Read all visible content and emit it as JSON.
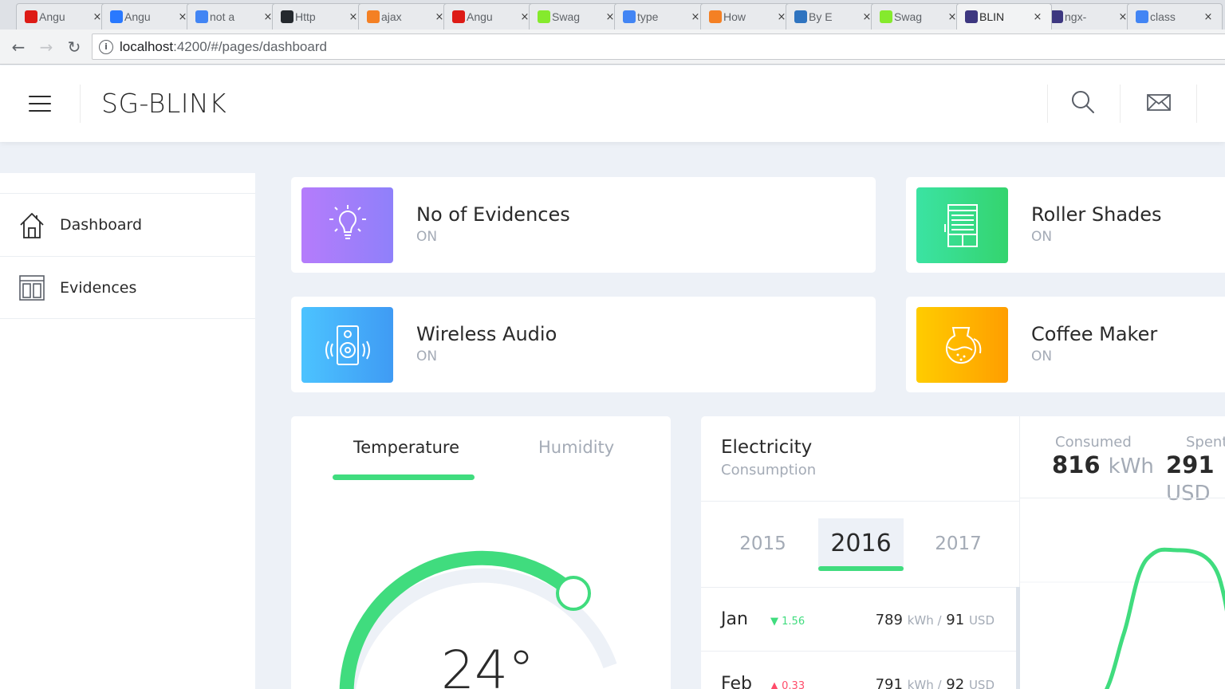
{
  "browser": {
    "tabs": [
      {
        "title": "Angu",
        "icon": "angular-icon",
        "color": "#dd1b16"
      },
      {
        "title": "Angu",
        "icon": "lightning-icon",
        "color": "#2979ff"
      },
      {
        "title": "not a",
        "icon": "google-icon",
        "color": "#4285f4"
      },
      {
        "title": "Http",
        "icon": "github-icon",
        "color": "#24292e"
      },
      {
        "title": "ajax",
        "icon": "stackoverflow-icon",
        "color": "#f48024"
      },
      {
        "title": "Angu",
        "icon": "angular-icon",
        "color": "#dd1b16"
      },
      {
        "title": "Swag",
        "icon": "swagger-icon",
        "color": "#85ea2d"
      },
      {
        "title": "type",
        "icon": "google-icon",
        "color": "#4285f4"
      },
      {
        "title": "How",
        "icon": "stackoverflow-icon",
        "color": "#f48024"
      },
      {
        "title": "By E",
        "icon": "typescript-icon",
        "color": "#2f74c0"
      },
      {
        "title": "Swag",
        "icon": "swagger-icon",
        "color": "#85ea2d"
      },
      {
        "title": "BLIN",
        "icon": "app-icon",
        "color": "#3d3780"
      },
      {
        "title": "ngx-",
        "icon": "app-icon",
        "color": "#3d3780"
      },
      {
        "title": "class",
        "icon": "google-icon",
        "color": "#4285f4"
      }
    ],
    "close_glyph": "×",
    "url_host": "localhost",
    "url_path": ":4200/#/pages/dashboard"
  },
  "header": {
    "brand": "SG-BLINK"
  },
  "sidebar": {
    "items": [
      {
        "label": "Dashboard",
        "icon": "home-icon"
      },
      {
        "label": "Evidences",
        "icon": "layout-icon"
      }
    ]
  },
  "status_cards": [
    {
      "title": "No of Evidences",
      "state": "ON",
      "icon": "light-bulb-icon",
      "gradient": [
        "#b57cfb",
        "#8f80fa"
      ]
    },
    {
      "title": "Roller Shades",
      "state": "ON",
      "icon": "roller-shades-icon",
      "gradient": [
        "#3be3a3",
        "#34d46e"
      ]
    },
    {
      "title": "Wireless Audio",
      "state": "ON",
      "icon": "speaker-icon",
      "gradient": [
        "#4cc3ff",
        "#3f9bf4"
      ]
    },
    {
      "title": "Coffee Maker",
      "state": "ON",
      "icon": "coffee-maker-icon",
      "gradient": [
        "#ffcc00",
        "#ff9e00"
      ]
    }
  ],
  "temperature": {
    "tabs": [
      "Temperature",
      "Humidity"
    ],
    "value": "24°",
    "accent": "#40dc7e"
  },
  "electricity": {
    "title": "Electricity",
    "subtitle": "Consumption",
    "years": [
      "2015",
      "2016",
      "2017"
    ],
    "months": [
      {
        "name": "Jan",
        "delta": "1.56",
        "dir": "down",
        "kwh": "789",
        "kwh_unit": "kWh /",
        "usd": "91",
        "usd_unit": "USD"
      },
      {
        "name": "Feb",
        "delta": "0.33",
        "dir": "up",
        "kwh": "791",
        "kwh_unit": "kWh /",
        "usd": "92",
        "usd_unit": "USD"
      }
    ],
    "consumed_label": "Consumed",
    "consumed_value": "816",
    "consumed_unit": "kWh",
    "spent_label": "Spent",
    "spent_value": "291",
    "spent_unit": "USD"
  }
}
